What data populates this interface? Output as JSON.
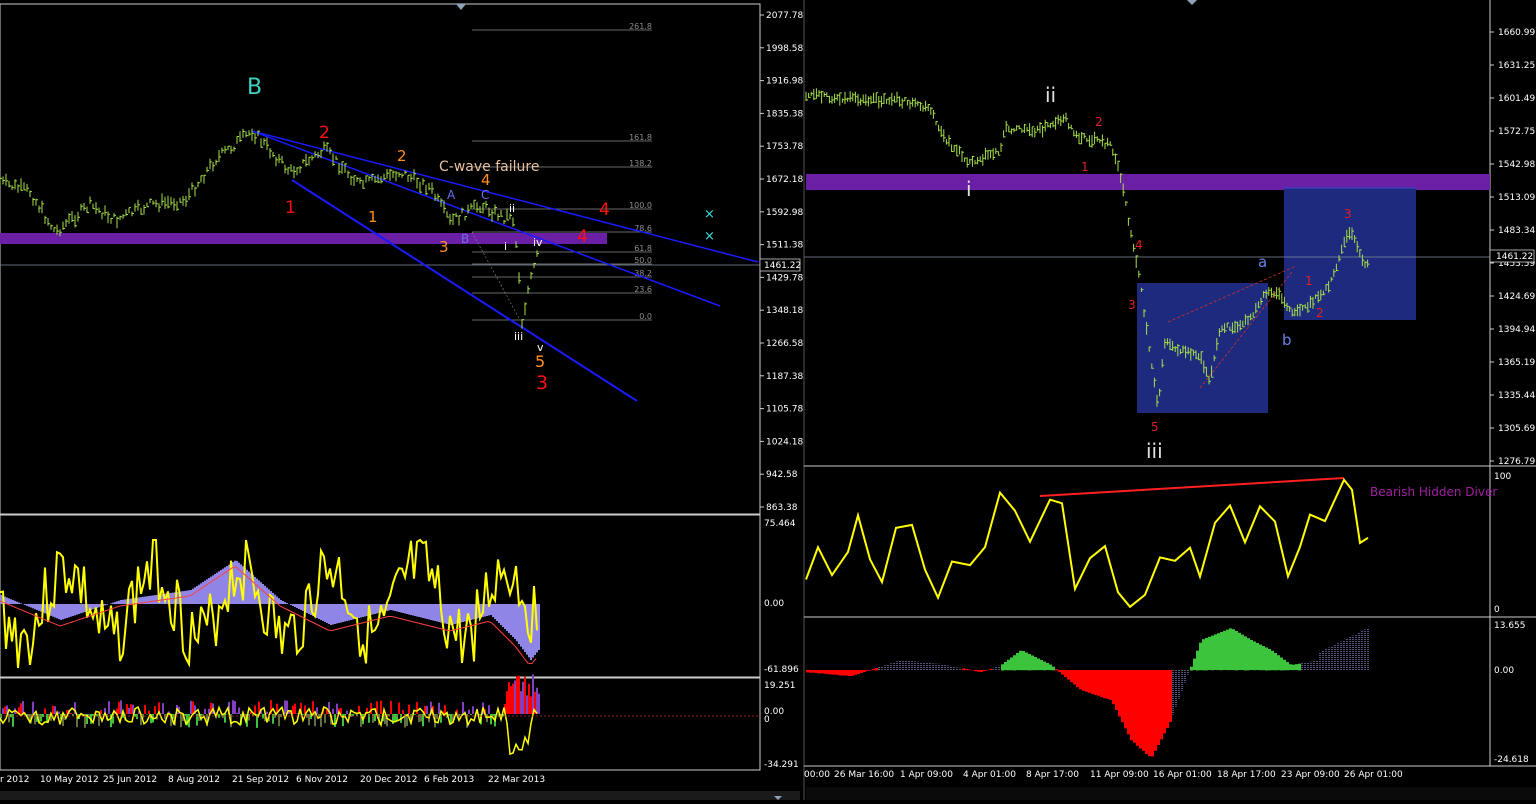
{
  "colors": {
    "background": "#000000",
    "price_bars": "#a6e04a",
    "oscillator_line": "#ffff00",
    "histogram_purple": "#8f85e6",
    "histogram_red": "#ff0000",
    "histogram_green": "#3cc43c",
    "resistance_zone": "#6a1fa4",
    "box": "#1e2a7d",
    "trendline": "#1a1aff",
    "annotation_text": "#d08080",
    "divergence_line": "#ff2020",
    "fib_levels": "#8c8c8c"
  },
  "left": {
    "price_axis": [
      "2077.78",
      "1998.58",
      "1916.98",
      "1835.38",
      "1753.78",
      "1672.18",
      "1592.98",
      "1511.38",
      "1429.78",
      "1348.18",
      "1266.58",
      "1187.38",
      "1105.78",
      "1024.18",
      "942.58",
      "863.38"
    ],
    "current_price": "1461.22",
    "dates": [
      "r 2012",
      "10 May 2012",
      "25 Jun 2012",
      "8 Aug 2012",
      "21 Sep 2012",
      "6 Nov 2012",
      "20 Dec 2012",
      "6 Feb 2013",
      "22 Mar 2013"
    ],
    "fib_levels": [
      "261.8",
      "161.8",
      "138.2",
      "100.0",
      "78.6",
      "61.8",
      "50.0",
      "38.2",
      "23.6",
      "0.0"
    ],
    "annotation": "C-wave failure",
    "waves": {
      "B": "B",
      "red": [
        "1",
        "2",
        "3",
        "4",
        "4"
      ],
      "orange": [
        "1",
        "2",
        "3",
        "4",
        "5"
      ],
      "abc": [
        "A",
        "B",
        "C"
      ],
      "white": [
        "i",
        "ii",
        "iii",
        "iv",
        "v"
      ],
      "marker": "×"
    },
    "osc1_axis": [
      "75.464",
      "0.00",
      "-61.896"
    ],
    "osc2_axis": [
      "19.251",
      "0.00",
      "0",
      "-34.291"
    ]
  },
  "right": {
    "price_axis": [
      "1660.99",
      "1631.25",
      "1601.49",
      "1572.75",
      "1542.98",
      "1513.09",
      "1483.34",
      "1453.59",
      "1424.69",
      "1394.94",
      "1365.19",
      "1335.44",
      "1305.69",
      "1276.79"
    ],
    "current_price": "1461.22",
    "dates": [
      "00:00",
      "26 Mar 16:00",
      "1 Apr 09:00",
      "4 Apr 01:00",
      "8 Apr 17:00",
      "11 Apr 09:00",
      "16 Apr 01:00",
      "18 Apr 17:00",
      "23 Apr 09:00",
      "26 Apr 01:00"
    ],
    "waves": {
      "big": [
        "i",
        "ii",
        "iii"
      ],
      "red": [
        "1",
        "2",
        "3",
        "4",
        "5",
        "1",
        "2",
        "3"
      ],
      "ab": [
        "a",
        "b"
      ]
    },
    "divergence_label": "Bearish Hidden Diver",
    "osc1_axis": [
      "100",
      "0"
    ],
    "osc2_axis": [
      "13.655",
      "0.00",
      "-24.618"
    ]
  }
}
